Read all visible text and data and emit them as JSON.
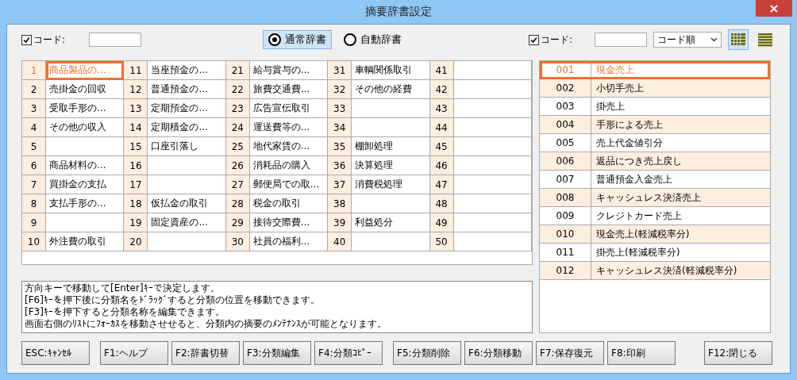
{
  "window": {
    "title": "摘要辞書設定"
  },
  "left_filter": {
    "label": "コード:",
    "checked": true
  },
  "dictionary_modes": [
    {
      "label": "通常辞書",
      "selected": true
    },
    {
      "label": "自動辞書",
      "selected": false
    }
  ],
  "right_filter": {
    "label": "コード:",
    "checked": true,
    "sort": "コード順"
  },
  "view_modes": [
    {
      "kind": "grid",
      "selected": true
    },
    {
      "kind": "list",
      "selected": false
    }
  ],
  "categories": [
    {
      "no": "1",
      "name": "商品製品の…",
      "selected": true
    },
    {
      "no": "2",
      "name": "売掛金の回収",
      "selected": false
    },
    {
      "no": "3",
      "name": "受取手形の…",
      "selected": false
    },
    {
      "no": "4",
      "name": "その他の収入",
      "selected": false
    },
    {
      "no": "5",
      "selected": false
    },
    {
      "no": "6",
      "name": "商品材料の…",
      "selected": false
    },
    {
      "no": "7",
      "name": "買掛金の支払",
      "selected": false
    },
    {
      "no": "8",
      "name": "支払手形の…",
      "selected": false
    },
    {
      "no": "9",
      "selected": false
    },
    {
      "no": "10",
      "name": "外注費の取引",
      "selected": false
    },
    {
      "no": "11",
      "name": "当座預金の…",
      "selected": false
    },
    {
      "no": "12",
      "name": "普通預金の…",
      "selected": false
    },
    {
      "no": "13",
      "name": "定期預金の…",
      "selected": false
    },
    {
      "no": "14",
      "name": "定期積金の…",
      "selected": false
    },
    {
      "no": "15",
      "name": "口座引落し",
      "selected": false
    },
    {
      "no": "16",
      "selected": false
    },
    {
      "no": "17",
      "selected": false
    },
    {
      "no": "18",
      "name": "仮払金の取引",
      "selected": false
    },
    {
      "no": "19",
      "name": "固定資産の…",
      "selected": false
    },
    {
      "no": "20",
      "selected": false
    },
    {
      "no": "21",
      "name": "給与賞与の…",
      "selected": false
    },
    {
      "no": "22",
      "name": "旅費交通費…",
      "selected": false
    },
    {
      "no": "23",
      "name": "広告宣伝取引",
      "selected": false
    },
    {
      "no": "24",
      "name": "運送費等の…",
      "selected": false
    },
    {
      "no": "25",
      "name": "地代家賃の…",
      "selected": false
    },
    {
      "no": "26",
      "name": "消耗品の購入",
      "selected": false
    },
    {
      "no": "27",
      "name": "郵便局での取…",
      "selected": false
    },
    {
      "no": "28",
      "name": "税金の取引",
      "selected": false
    },
    {
      "no": "29",
      "name": "接待交際費…",
      "selected": false
    },
    {
      "no": "30",
      "name": "社員の福利…",
      "selected": false
    },
    {
      "no": "31",
      "name": "車輌関係取引",
      "selected": false
    },
    {
      "no": "32",
      "name": "その他の経費",
      "selected": false
    },
    {
      "no": "33",
      "selected": false
    },
    {
      "no": "34",
      "selected": false
    },
    {
      "no": "35",
      "name": "棚卸処理",
      "selected": false
    },
    {
      "no": "36",
      "name": "決算処理",
      "selected": false
    },
    {
      "no": "37",
      "name": "消費税処理",
      "selected": false
    },
    {
      "no": "38",
      "selected": false
    },
    {
      "no": "39",
      "name": "利益処分",
      "selected": false
    },
    {
      "no": "40",
      "selected": false
    },
    {
      "no": "41",
      "selected": false
    },
    {
      "no": "42",
      "selected": false
    },
    {
      "no": "43",
      "selected": false
    },
    {
      "no": "44",
      "selected": false
    },
    {
      "no": "45",
      "selected": false
    },
    {
      "no": "46",
      "selected": false
    },
    {
      "no": "47",
      "selected": false
    },
    {
      "no": "48",
      "selected": false
    },
    {
      "no": "49",
      "selected": false
    },
    {
      "no": "50",
      "selected": false
    }
  ],
  "entries": [
    {
      "code": "001",
      "name": "現金売上",
      "selected": true
    },
    {
      "code": "002",
      "name": "小切手売上",
      "selected": false
    },
    {
      "code": "003",
      "name": "掛売上",
      "selected": false
    },
    {
      "code": "004",
      "name": "手形による売上",
      "selected": false
    },
    {
      "code": "005",
      "name": "売上代金値引分",
      "selected": false
    },
    {
      "code": "006",
      "name": "返品につき売上戻し",
      "selected": false
    },
    {
      "code": "007",
      "name": "普通預金入金売上",
      "selected": false
    },
    {
      "code": "008",
      "name": "キャッシュレス決済売上",
      "selected": false
    },
    {
      "code": "009",
      "name": "クレジトカード売上",
      "selected": false
    },
    {
      "code": "010",
      "name": "現金売上(軽減税率分)",
      "selected": false
    },
    {
      "code": "011",
      "name": "掛売上(軽減税率分)",
      "selected": false
    },
    {
      "code": "012",
      "name": "キャッシュレス決済(軽減税率分)",
      "selected": false
    }
  ],
  "help_lines": [
    "方向キーで移動して[Enter]ｷｰで決定します。",
    "[F6]ｷｰを押下後に分類名をﾄﾞﾗｯｸﾞすると分類の位置を移動できます。",
    "[F3]ｷｰを押下すると分類名称を編集できます。",
    "画面右側のﾘｽﾄにﾌｫｰｶｽを移動させせると、分類内の摘要のﾒﾝﾃﾅﾝｽが可能となります。"
  ],
  "buttons": [
    "ESC:ｷｬﾝｾﾙ",
    "F1:ヘルプ",
    "F2:辞書切替",
    "F3:分類編集",
    "F4:分類ｺﾋﾟｰ",
    "F5:分類削除",
    "F6:分類移動",
    "F7:保存復元",
    "F8:印刷",
    "F12:閉じる"
  ]
}
